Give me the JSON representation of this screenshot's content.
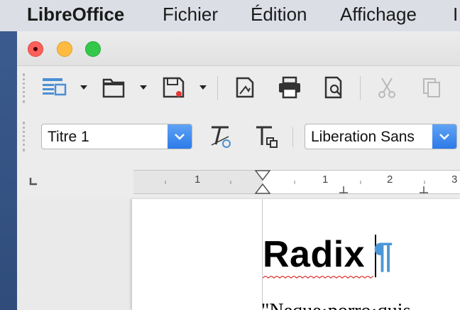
{
  "menubar": {
    "app_name": "LibreOffice",
    "items": [
      "Fichier",
      "Édition",
      "Affichage",
      "I"
    ]
  },
  "toolbar": {
    "buttons": [
      "sidebar-toggle-icon",
      "open-folder-icon",
      "save-icon",
      "export-pdf-icon",
      "print-icon",
      "print-preview-icon",
      "cut-icon",
      "copy-icon"
    ]
  },
  "formatting": {
    "paragraph_style": "Titre 1",
    "font_name": "Liberation Sans"
  },
  "ruler": {
    "labels": [
      "1",
      "1",
      "2",
      "3"
    ]
  },
  "document": {
    "heading": "Radix",
    "pilcrow": "¶",
    "body_start": "\"Neque·porro·quis"
  },
  "colors": {
    "accent": "#2d7ae8",
    "pilcrow": "#4a96d6",
    "spellcheck_squiggle": "#e03030"
  }
}
